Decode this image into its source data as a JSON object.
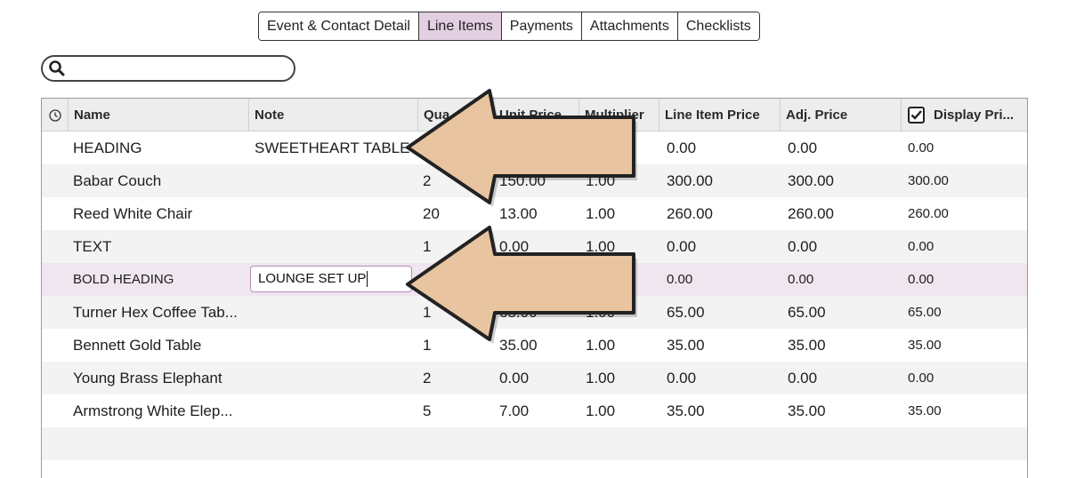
{
  "tabs": [
    {
      "label": "Event & Contact Detail",
      "active": false
    },
    {
      "label": "Line Items",
      "active": true
    },
    {
      "label": "Payments",
      "active": false
    },
    {
      "label": "Attachments",
      "active": false
    },
    {
      "label": "Checklists",
      "active": false
    }
  ],
  "search": {
    "value": "",
    "placeholder": ""
  },
  "columns": [
    "Name",
    "Note",
    "Qua",
    "Unit Price",
    "Multiplier",
    "Line Item Price",
    "Adj. Price",
    "Display Pri..."
  ],
  "display_price_checkbox": {
    "checked": true
  },
  "rows": [
    {
      "name": "HEADING",
      "note": "SWEETHEART TABLE",
      "qty": "",
      "unit": "",
      "mult": "",
      "line": "0.00",
      "adj": "0.00",
      "display": "0.00"
    },
    {
      "name": "Babar Couch",
      "note": "",
      "qty": "2",
      "unit": "150.00",
      "mult": "1.00",
      "line": "300.00",
      "adj": "300.00",
      "display": "300.00"
    },
    {
      "name": "Reed White Chair",
      "note": "",
      "qty": "20",
      "unit": "13.00",
      "mult": "1.00",
      "line": "260.00",
      "adj": "260.00",
      "display": "260.00"
    },
    {
      "name": "TEXT",
      "note": "",
      "qty": "1",
      "unit": "0.00",
      "mult": "1.00",
      "line": "0.00",
      "adj": "0.00",
      "display": "0.00"
    },
    {
      "name": "BOLD HEADING",
      "note": "LOUNGE SET UP",
      "qty": "",
      "unit": "",
      "mult": "",
      "line": "0.00",
      "adj": "0.00",
      "display": "0.00"
    },
    {
      "name": "Turner Hex Coffee Tab...",
      "note": "",
      "qty": "1",
      "unit": "65.00",
      "mult": "1.00",
      "line": "65.00",
      "adj": "65.00",
      "display": "65.00"
    },
    {
      "name": "Bennett Gold Table",
      "note": "",
      "qty": "1",
      "unit": "35.00",
      "mult": "1.00",
      "line": "35.00",
      "adj": "35.00",
      "display": "35.00"
    },
    {
      "name": "Young Brass Elephant",
      "note": "",
      "qty": "2",
      "unit": "0.00",
      "mult": "1.00",
      "line": "0.00",
      "adj": "0.00",
      "display": "0.00"
    },
    {
      "name": "Armstrong White Elep...",
      "note": "",
      "qty": "5",
      "unit": "7.00",
      "mult": "1.00",
      "line": "35.00",
      "adj": "35.00",
      "display": "35.00"
    }
  ],
  "colors": {
    "active_tab": "#e2cfe2",
    "selected_row": "#efe6f0",
    "arrow_fill": "#e8c4a0",
    "arrow_stroke": "#222222"
  }
}
